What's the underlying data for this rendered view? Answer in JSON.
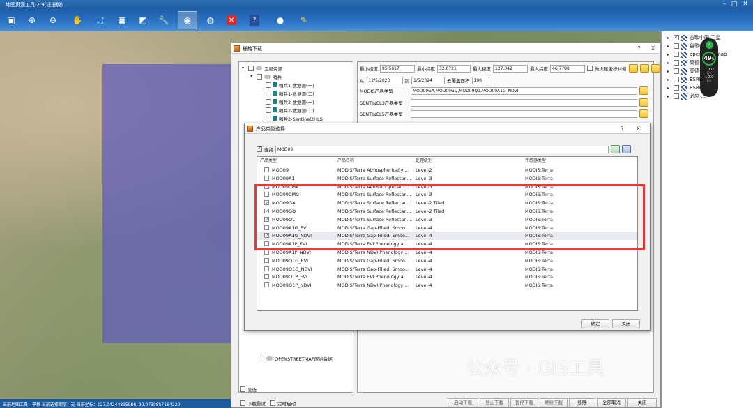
{
  "app": {
    "title": "地图资源工具-2.9(注册版)"
  },
  "toolbar": [
    "save-icon",
    "zoom-in-icon",
    "zoom-out-icon",
    "pan-hand-icon",
    "extent-icon",
    "grid-icon",
    "select-icon",
    "tool-icon",
    "globe-pin-icon",
    "world-icon",
    "close-icon",
    "help-icon",
    "user-icon",
    "pen-icon"
  ],
  "layers_panel": {
    "items": [
      {
        "label": "谷歌中国-卫星",
        "checked": true
      },
      {
        "label": "谷歌中国...",
        "checked": false
      },
      {
        "label": "openstreetmap",
        "checked": false
      },
      {
        "label": "高德-...",
        "checked": false
      },
      {
        "label": "高德-...",
        "checked": false
      },
      {
        "label": "ESRI-...",
        "checked": false
      },
      {
        "label": "ESRI-...",
        "checked": false
      },
      {
        "label": "必应-...",
        "checked": false
      }
    ],
    "speed": {
      "value": "49",
      "unit": "%",
      "up": "0.0",
      "down": "0.0",
      "rate": "K/s"
    }
  },
  "status": {
    "text": "当前地图工具：平移  当前选择图层：无  当前坐标：127.04244895986, 32.0730857164229"
  },
  "grid_dialog": {
    "title": "栅格下载",
    "help": "?",
    "close": "X",
    "tree": {
      "root": "卫星资源",
      "group": "哨兵",
      "children": [
        "哨兵1-数据源(一)",
        "哨兵1-数据源(二)",
        "哨兵2-数据源(一)",
        "哨兵2-数据源(二)",
        "哨兵2-Sentinel2HLS"
      ],
      "bottom": "OPENSTREETMAP原始数据",
      "select_all": "全选"
    },
    "coords": {
      "min_lon_label": "最小经度",
      "min_lon": "95.5617",
      "min_lat_label": "最小纬度",
      "min_lat": "32.0721",
      "max_lon_label": "最大经度",
      "max_lon": "127.042",
      "max_lat_label": "最大纬度",
      "max_lat": "46.7788",
      "mars_label": "做火星坐标纠偏"
    },
    "dates": {
      "from_label": "从",
      "from": "12/5/2023",
      "to_label": "到",
      "to": "1/5/2024",
      "cloud_label": "云覆盖面积",
      "cloud": "100"
    },
    "modis_label": "MODIS产品类型",
    "modis_value": "MOD09GA,MOD09GQ,MOD09Q1,MOD09A1G_NDVI",
    "s3_label": "SENTINEL3产品类型",
    "s5_label": "SENTINEL5产品类型",
    "footer": {
      "download_retry": "下载重试",
      "timed_start": "定时启动",
      "buttons": [
        "启动下载",
        "停止下载",
        "暂停下载",
        "继续下载",
        "移除",
        "全部取消",
        "关闭"
      ]
    }
  },
  "product_dialog": {
    "title": "产品类型选择",
    "help": "?",
    "close": "X",
    "search_label": "查找",
    "search_value": "MOD09",
    "columns": [
      "产品类型",
      "产品名称",
      "处理级别",
      "传感器类型"
    ],
    "rows": [
      {
        "type": "MOD09",
        "name": "MODIS/Terra Atmospherically ...",
        "level": "Level-2",
        "sensor": "MODIS:Terra",
        "checked": false
      },
      {
        "type": "MOD09A1",
        "name": "MODIS/Terra Surface Reflectan...",
        "level": "Level-3",
        "sensor": "MODIS:Terra",
        "checked": false
      },
      {
        "type": "MOD09CMA",
        "name": "MODIS/Terra Aerosol Optical T...",
        "level": "Level-3",
        "sensor": "MODIS:Terra",
        "checked": false
      },
      {
        "type": "MOD09CMG",
        "name": "MODIS/Terra Surface Reflectan...",
        "level": "Level-3",
        "sensor": "MODIS:Terra",
        "checked": false
      },
      {
        "type": "MOD09GA",
        "name": "MODIS/Terra Surface Reflectan...",
        "level": "Level-2 Tiled",
        "sensor": "MODIS:Terra",
        "checked": true
      },
      {
        "type": "MOD09GQ",
        "name": "MODIS/Terra Surface Reflectan...",
        "level": "Level-2 Tiled",
        "sensor": "MODIS:Terra",
        "checked": true
      },
      {
        "type": "MOD09Q1",
        "name": "MODIS/Terra Surface Reflectan...",
        "level": "Level-3",
        "sensor": "MODIS:Terra",
        "checked": true
      },
      {
        "type": "MOD09A1G_EVI",
        "name": "MODIS/Terra Gap-Filled, Smoo...",
        "level": "Level-4",
        "sensor": "MODIS:Terra",
        "checked": false
      },
      {
        "type": "MOD09A1G_NDVI",
        "name": "MODIS/Terra Gap-Filled, Smoo...",
        "level": "Level-4",
        "sensor": "MODIS:Terra",
        "checked": true
      },
      {
        "type": "MOD09A1P_EVI",
        "name": "MODIS/Terra EVI Phenology a...",
        "level": "Level-4",
        "sensor": "MODIS:Terra",
        "checked": false
      },
      {
        "type": "MOD09A1P_NDVI",
        "name": "MODIS/Terra NDVI Phenology ...",
        "level": "Level-4",
        "sensor": "MODIS:Terra",
        "checked": false
      },
      {
        "type": "MOD09Q1G_EVI",
        "name": "MODIS/Terra Gap-Filled, Smoo...",
        "level": "Level-4",
        "sensor": "MODIS:Terra",
        "checked": false
      },
      {
        "type": "MOD09Q1G_NDVI",
        "name": "MODIS/Terra Gap-Filled, Smoo...",
        "level": "Level-4",
        "sensor": "MODIS:Terra",
        "checked": false
      },
      {
        "type": "MOD09Q1P_EVI",
        "name": "MODIS/Terra EVI Phenology a...",
        "level": "Level-4",
        "sensor": "MODIS:Terra",
        "checked": false
      },
      {
        "type": "MOD09Q1P_NDVI",
        "name": "MODIS/Terra NDVI Phenology ...",
        "level": "Level-4",
        "sensor": "MODIS:Terra",
        "checked": false
      }
    ],
    "ok": "确定",
    "close_btn": "关闭"
  },
  "watermark": "公众号 · GIS工具",
  "colors": {
    "titlebar": "#1f5c9e",
    "overlay": "#6a5fc0",
    "highlight": "#e83a3a"
  }
}
